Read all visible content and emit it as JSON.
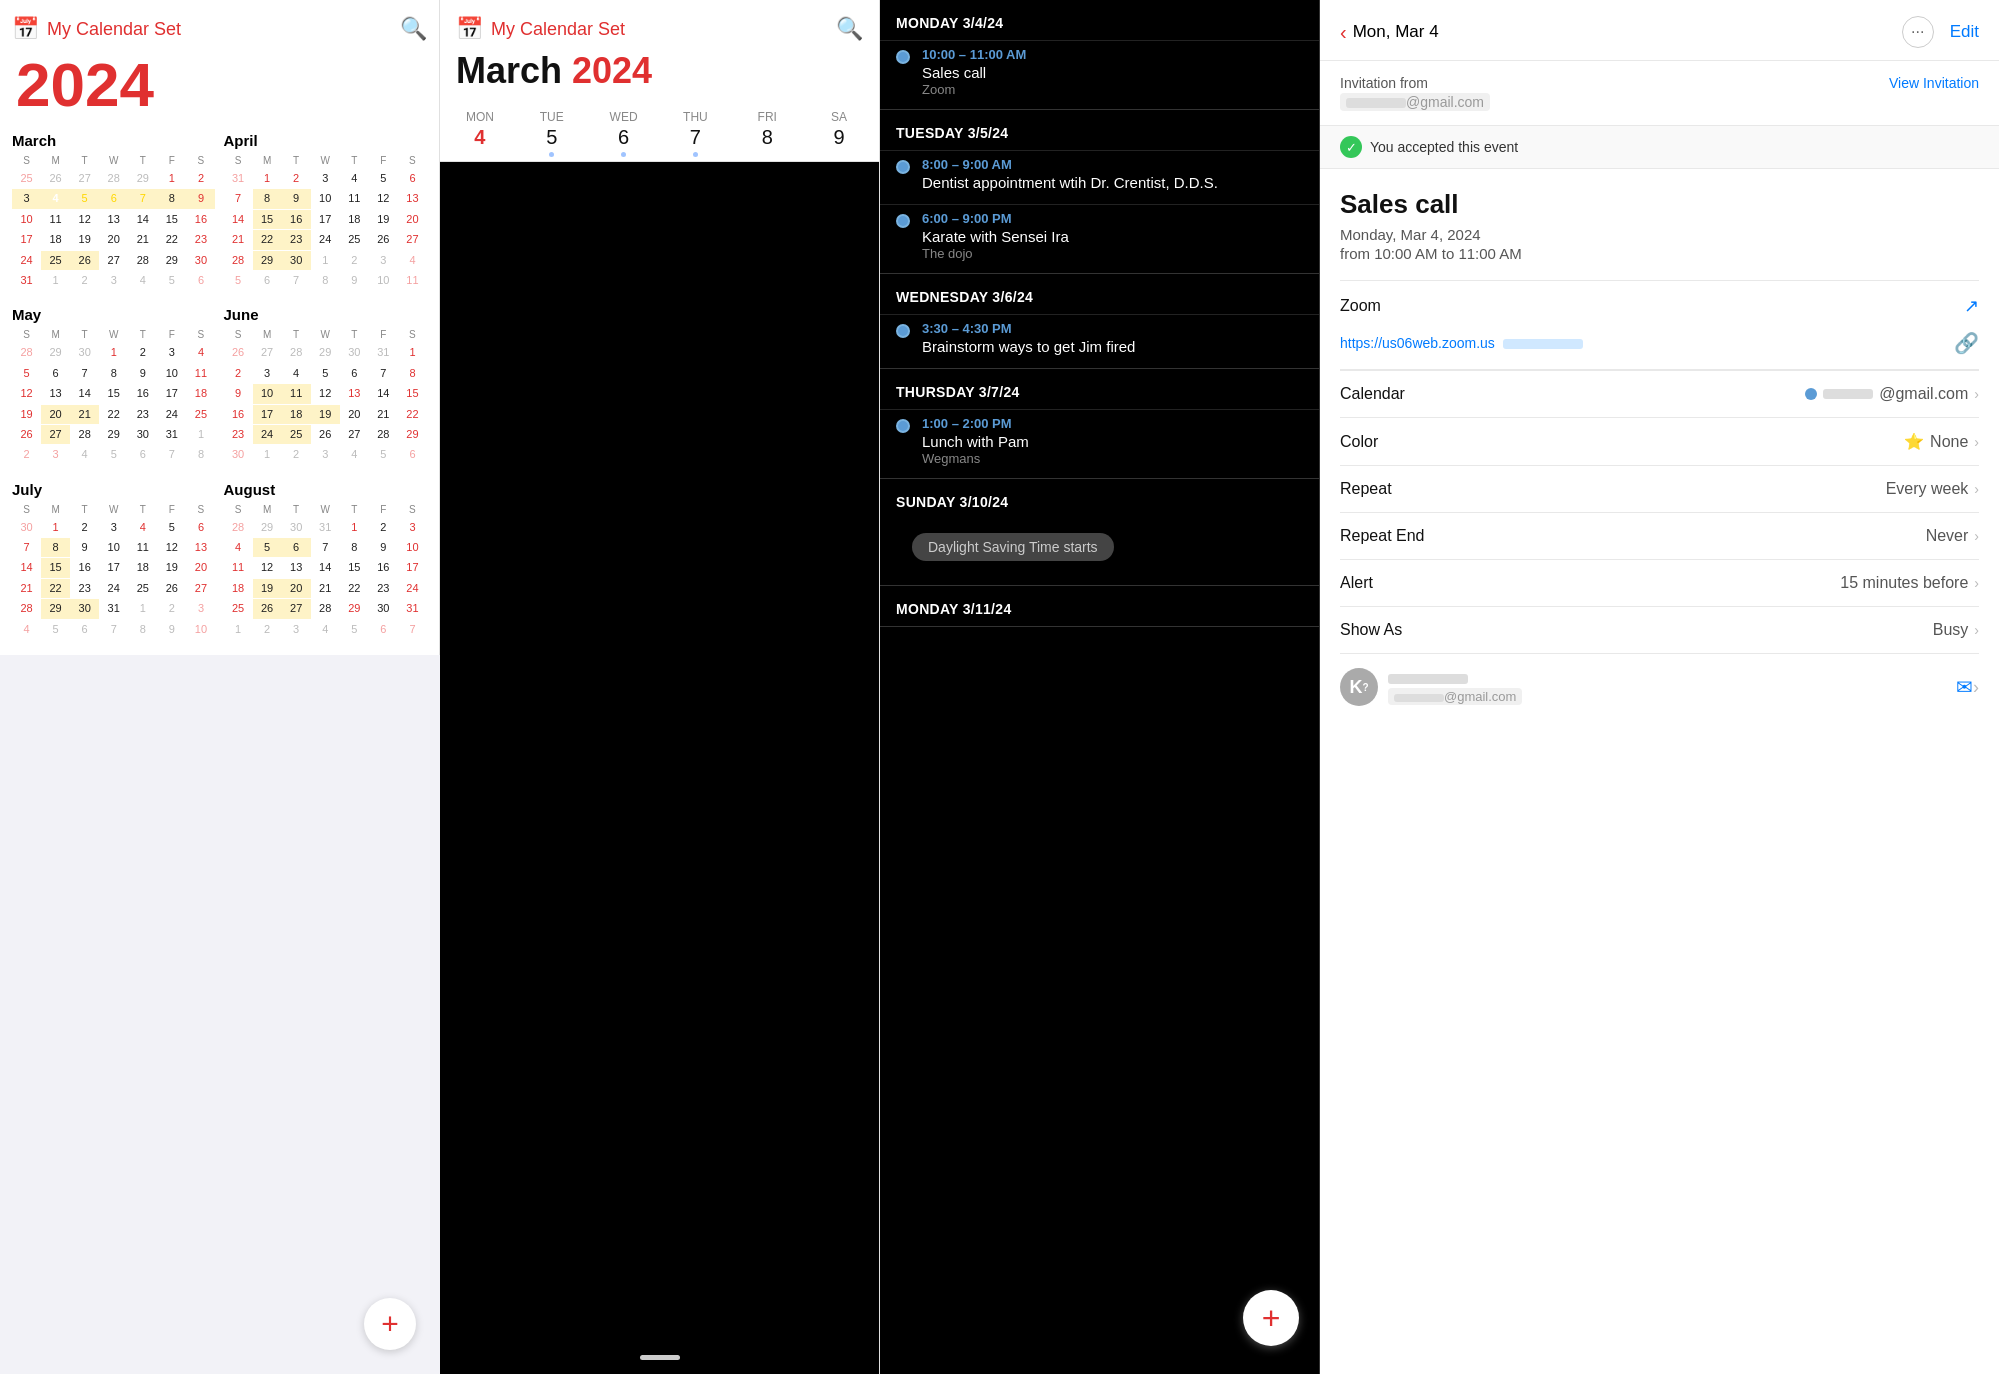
{
  "panel1": {
    "header": {
      "icon": "📅",
      "title": "My Calendar Set",
      "search_icon": "🔍"
    },
    "year": "2024",
    "months": [
      {
        "name": "March",
        "days_of_week": [
          "S",
          "M",
          "T",
          "W",
          "T",
          "F",
          "S"
        ],
        "weeks": [
          [
            "25",
            "26",
            "27",
            "28",
            "29",
            "1",
            "2"
          ],
          [
            "3",
            "4",
            "5",
            "6",
            "7",
            "8",
            "9"
          ],
          [
            "10",
            "11",
            "12",
            "13",
            "14",
            "15",
            "16"
          ],
          [
            "17",
            "18",
            "19",
            "20",
            "21",
            "22",
            "23"
          ],
          [
            "24",
            "25",
            "26",
            "27",
            "28",
            "29",
            "30"
          ],
          [
            "31",
            "1",
            "2",
            "3",
            "4",
            "5",
            "6"
          ]
        ],
        "today": "4",
        "selected_week": [
          "3",
          "4",
          "5",
          "6",
          "7",
          "8",
          "9"
        ],
        "other_month_start": [
          "25",
          "26",
          "27",
          "28",
          "29"
        ],
        "other_month_end": [
          "1",
          "2",
          "3",
          "4",
          "5",
          "6"
        ]
      },
      {
        "name": "April",
        "days_of_week": [
          "S",
          "M",
          "T",
          "W",
          "T",
          "F",
          "S"
        ],
        "weeks": [
          [
            "31",
            "1",
            "2",
            "3",
            "4",
            "5",
            "6"
          ],
          [
            "7",
            "8",
            "9",
            "10",
            "11",
            "12",
            "13"
          ],
          [
            "14",
            "15",
            "16",
            "17",
            "18",
            "19",
            "20"
          ],
          [
            "21",
            "22",
            "23",
            "24",
            "25",
            "26",
            "27"
          ],
          [
            "28",
            "29",
            "30",
            "1",
            "2",
            "3",
            "4"
          ],
          [
            "5",
            "6",
            "7",
            "8",
            "9",
            "10",
            "11"
          ]
        ]
      },
      {
        "name": "May",
        "days_of_week": [
          "S",
          "M",
          "T",
          "W",
          "T",
          "F",
          "S"
        ],
        "weeks": [
          [
            "28",
            "29",
            "30",
            "1",
            "2",
            "3",
            "4"
          ],
          [
            "5",
            "6",
            "7",
            "8",
            "9",
            "10",
            "11"
          ],
          [
            "12",
            "13",
            "14",
            "15",
            "16",
            "17",
            "18"
          ],
          [
            "19",
            "20",
            "21",
            "22",
            "23",
            "24",
            "25"
          ],
          [
            "26",
            "27",
            "28",
            "29",
            "30",
            "31",
            "1"
          ],
          [
            "2",
            "3",
            "4",
            "5",
            "6",
            "7",
            "8"
          ]
        ]
      },
      {
        "name": "June",
        "days_of_week": [
          "S",
          "M",
          "T",
          "W",
          "T",
          "F",
          "S"
        ],
        "weeks": [
          [
            "26",
            "27",
            "28",
            "29",
            "30",
            "31",
            "1"
          ],
          [
            "2",
            "3",
            "4",
            "5",
            "6",
            "7",
            "8"
          ],
          [
            "9",
            "10",
            "11",
            "12",
            "13",
            "14",
            "15"
          ],
          [
            "16",
            "17",
            "18",
            "19",
            "20",
            "21",
            "22"
          ],
          [
            "23",
            "24",
            "25",
            "26",
            "27",
            "28",
            "29"
          ],
          [
            "30",
            "1",
            "2",
            "3",
            "4",
            "5",
            "6"
          ]
        ]
      },
      {
        "name": "July",
        "days_of_week": [
          "S",
          "M",
          "T",
          "W",
          "T",
          "F",
          "S"
        ],
        "weeks": [
          [
            "30",
            "1",
            "2",
            "3",
            "4",
            "5",
            "6"
          ],
          [
            "7",
            "8",
            "9",
            "10",
            "11",
            "12",
            "13"
          ],
          [
            "14",
            "15",
            "16",
            "17",
            "18",
            "19",
            "20"
          ],
          [
            "21",
            "22",
            "23",
            "24",
            "25",
            "26",
            "27"
          ],
          [
            "28",
            "29",
            "30",
            "31",
            "1",
            "2",
            "3"
          ],
          [
            "4",
            "5",
            "6",
            "7",
            "8",
            "9",
            "10"
          ]
        ]
      },
      {
        "name": "August",
        "days_of_week": [
          "S",
          "M",
          "T",
          "W",
          "T",
          "F",
          "S"
        ],
        "weeks": [
          [
            "28",
            "29",
            "30",
            "31",
            "1",
            "2",
            "3"
          ],
          [
            "4",
            "5",
            "6",
            "7",
            "8",
            "9",
            "10"
          ],
          [
            "11",
            "12",
            "13",
            "14",
            "15",
            "16",
            "17"
          ],
          [
            "18",
            "19",
            "20",
            "21",
            "22",
            "23",
            "24"
          ],
          [
            "25",
            "26",
            "27",
            "28",
            "29",
            "30",
            "31"
          ],
          [
            "1",
            "2",
            "3",
            "4",
            "5",
            "6",
            "7"
          ]
        ]
      }
    ],
    "add_button": "+"
  },
  "panel2": {
    "header": {
      "icon": "📅",
      "title": "My Calendar Set",
      "search_icon": "🔍"
    },
    "month_title": {
      "month": "March",
      "year": "2024"
    },
    "week_cols": [
      {
        "day_name": "MON",
        "day_num": "4",
        "is_today": true,
        "has_dot": false
      },
      {
        "day_name": "TUE",
        "day_num": "5",
        "is_today": false,
        "has_dot": true
      },
      {
        "day_name": "WED",
        "day_num": "6",
        "is_today": false,
        "has_dot": true
      },
      {
        "day_name": "THU",
        "day_num": "7",
        "is_today": false,
        "has_dot": true
      },
      {
        "day_name": "FRI",
        "day_num": "8",
        "is_today": false,
        "has_dot": false
      },
      {
        "day_name": "SA",
        "day_num": "9",
        "is_today": false,
        "has_dot": false
      }
    ]
  },
  "panel3": {
    "events": [
      {
        "day": "MONDAY",
        "date": "3/4/24",
        "items": [
          {
            "time": "10:00 – 11:00 AM",
            "title": "Sales call",
            "location": "Zoom"
          }
        ]
      },
      {
        "day": "TUESDAY",
        "date": "3/5/24",
        "items": [
          {
            "time": "8:00 – 9:00 AM",
            "title": "Dentist appointment wtih Dr. Crentist, D.D.S.",
            "location": ""
          },
          {
            "time": "6:00 – 9:00 PM",
            "title": "Karate with Sensei Ira",
            "location": "The dojo"
          }
        ]
      },
      {
        "day": "WEDNESDAY",
        "date": "3/6/24",
        "items": [
          {
            "time": "3:30 – 4:30 PM",
            "title": "Brainstorm ways to get Jim fired",
            "location": ""
          }
        ]
      },
      {
        "day": "THURSDAY",
        "date": "3/7/24",
        "items": [
          {
            "time": "1:00 – 2:00 PM",
            "title": "Lunch with Pam",
            "location": "Wegmans"
          }
        ]
      },
      {
        "day": "SUNDAY",
        "date": "3/10/24",
        "items": []
      }
    ],
    "dst_badge": "Daylight Saving Time starts",
    "fab_label": "+"
  },
  "panel4": {
    "header": {
      "back_label": "Mon, Mar 4",
      "more_icon": "···",
      "edit_label": "Edit"
    },
    "invitation": {
      "from_label": "Invitation from",
      "email": "@gmail.com",
      "view_button": "View Invitation"
    },
    "accepted": {
      "text": "You accepted this event"
    },
    "event": {
      "title": "Sales call",
      "date": "Monday, Mar 4, 2024",
      "time_from": "from 10:00 AM to 11:00 AM"
    },
    "zoom": {
      "label": "Zoom",
      "link": "https://us06web.zoom.us",
      "link_suffix": "..."
    },
    "calendar": {
      "label": "Calendar",
      "value": "@gmail.com"
    },
    "color": {
      "label": "Color",
      "icon": "⭐",
      "value": "None"
    },
    "repeat": {
      "label": "Repeat",
      "value": "Every week"
    },
    "repeat_end": {
      "label": "Repeat End",
      "value": "Never"
    },
    "alert": {
      "label": "Alert",
      "value": "15 minutes before"
    },
    "show_as": {
      "label": "Show As",
      "value": "Busy"
    },
    "attendee": {
      "initial": "K",
      "question_mark": "?",
      "email": "@gmail.com"
    }
  }
}
